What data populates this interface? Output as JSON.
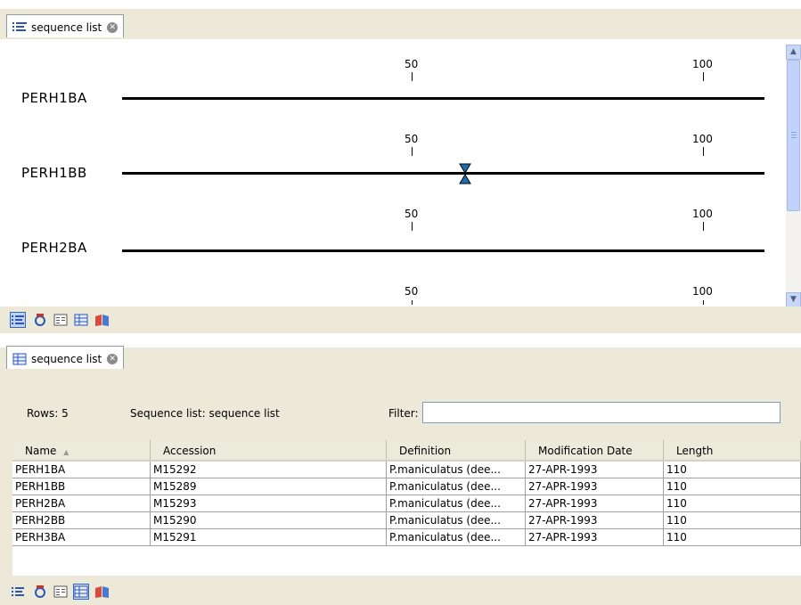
{
  "top_editor": {
    "tab_label": "sequence list",
    "tracks": [
      {
        "name": "PERH1BA",
        "ticks": [
          "50",
          "100"
        ]
      },
      {
        "name": "PERH1BB",
        "ticks": [
          "50",
          "100"
        ]
      },
      {
        "name": "PERH2BA",
        "ticks": [
          "50",
          "100"
        ]
      },
      {
        "name": "",
        "ticks": [
          "50",
          "100"
        ]
      }
    ],
    "toolbar_icons": [
      "sequence-view-icon",
      "circular-view-icon",
      "text-view-icon",
      "table-view-icon",
      "history-icon"
    ]
  },
  "bottom_editor": {
    "tab_label": "sequence list",
    "rows_label": "Rows: 5",
    "list_label": "Sequence list: sequence list",
    "filter_label": "Filter:",
    "filter_value": "",
    "columns": [
      "Name",
      "Accession",
      "Definition",
      "Modification Date",
      "Length"
    ],
    "rows": [
      [
        "PERH1BA",
        "M15292",
        "P.maniculatus (dee...",
        "27-APR-1993",
        "110"
      ],
      [
        "PERH1BB",
        "M15289",
        "P.maniculatus (dee...",
        "27-APR-1993",
        "110"
      ],
      [
        "PERH2BA",
        "M15293",
        "P.maniculatus (dee...",
        "27-APR-1993",
        "110"
      ],
      [
        "PERH2BB",
        "M15290",
        "P.maniculatus (dee...",
        "27-APR-1993",
        "110"
      ],
      [
        "PERH3BA",
        "M15291",
        "P.maniculatus (dee...",
        "27-APR-1993",
        "110"
      ]
    ]
  },
  "colors": {
    "chrome": "#ece9d8",
    "selection": "#316ac5",
    "cursor": "#1f6fb0"
  }
}
